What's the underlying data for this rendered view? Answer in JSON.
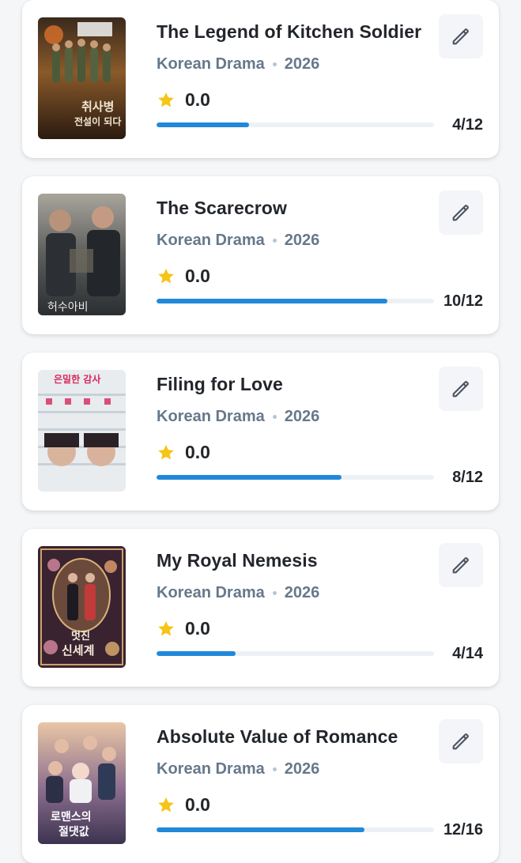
{
  "colors": {
    "accent": "#2288d8",
    "track": "#edf1f5",
    "star": "#f5c518",
    "title": "#22262b",
    "meta": "#66788b"
  },
  "icons": {
    "edit": "pencil-icon",
    "rating": "star-icon"
  },
  "items": [
    {
      "title": "The Legend of Kitchen Soldier",
      "genre": "Korean Drama",
      "year": "2026",
      "rating": "0.0",
      "episodes": "4/12",
      "progress": 0.333,
      "poster_text": [
        "취사병",
        "전설이 되다"
      ]
    },
    {
      "title": "The Scarecrow",
      "genre": "Korean Drama",
      "year": "2026",
      "rating": "0.0",
      "episodes": "10/12",
      "progress": 0.833,
      "poster_text": [
        "허수아비"
      ]
    },
    {
      "title": "Filing for Love",
      "genre": "Korean Drama",
      "year": "2026",
      "rating": "0.0",
      "episodes": "8/12",
      "progress": 0.667,
      "poster_text": [
        "은밀한 감사"
      ]
    },
    {
      "title": "My Royal Nemesis",
      "genre": "Korean Drama",
      "year": "2026",
      "rating": "0.0",
      "episodes": "4/14",
      "progress": 0.286,
      "poster_text": [
        "멋진",
        "신세계"
      ]
    },
    {
      "title": "Absolute Value of Romance",
      "genre": "Korean Drama",
      "year": "2026",
      "rating": "0.0",
      "episodes": "12/16",
      "progress": 0.75,
      "poster_text": [
        "로맨스의",
        "절댓값"
      ]
    }
  ]
}
